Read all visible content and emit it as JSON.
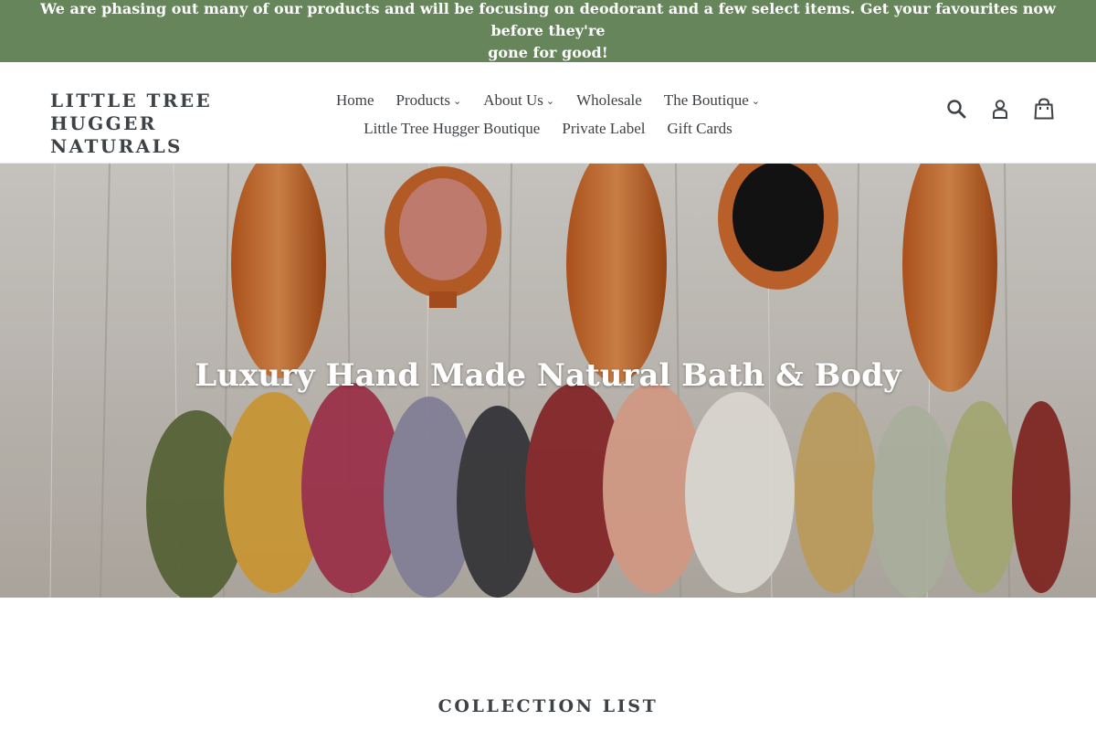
{
  "announcement": {
    "text_line1": "We are phasing out many of our products and will be focusing on deodorant and a few select items. Get your favourites now before they're",
    "text_line2": "gone for good!"
  },
  "header": {
    "logo_line1": "LITTLE TREE HUGGER",
    "logo_line2": "NATURALS",
    "nav": {
      "home": "Home",
      "products": "Products",
      "about_us": "About Us",
      "wholesale": "Wholesale",
      "the_boutique": "The Boutique",
      "little_tree_hugger_boutique": "Little Tree Hugger Boutique",
      "private_label": "Private Label",
      "gift_cards": "Gift Cards"
    },
    "icons": [
      "search-icon",
      "account-icon",
      "cart-icon"
    ]
  },
  "hero": {
    "title": "Luxury Hand Made Natural Bath & Body"
  },
  "collection": {
    "title": "COLLECTION LIST"
  },
  "colors": {
    "announcement_bg": "#66855a",
    "text": "#3d4246"
  }
}
